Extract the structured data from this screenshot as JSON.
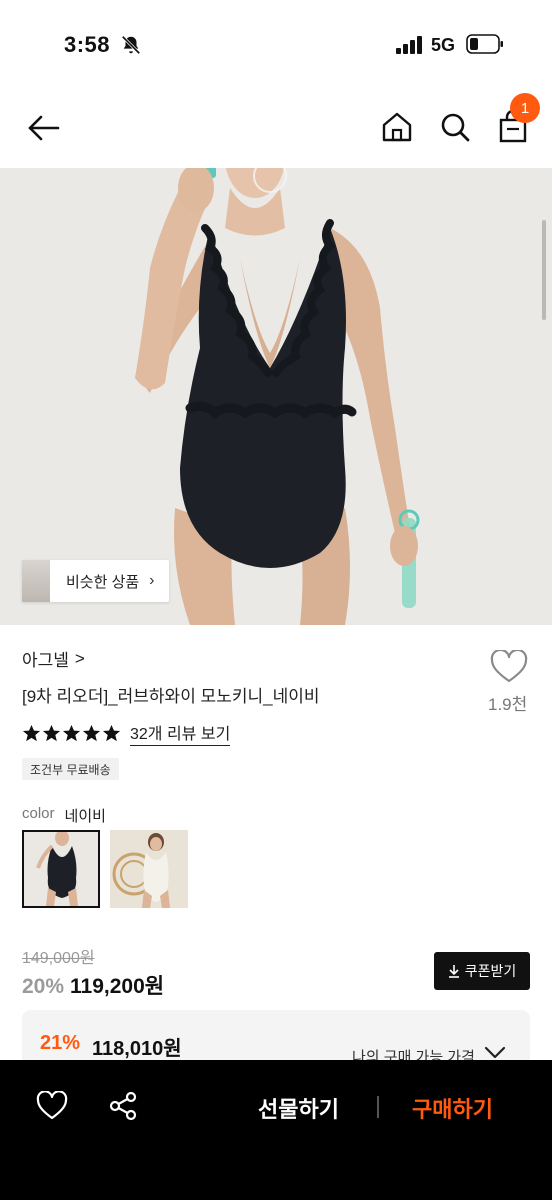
{
  "status": {
    "time": "3:58",
    "network": "5G"
  },
  "nav": {
    "cart_count": "1"
  },
  "hero": {
    "similar_label": "비슷한 상품",
    "chevron": "›"
  },
  "product": {
    "brand": "아그넬",
    "brand_chevron": ">",
    "name": "[9차 리오더]_러브하와이 모노키니_네이비",
    "like_count": "1.9천",
    "rating_stars": 5,
    "review_link": "32개 리뷰 보기",
    "shipping_badge": "조건부 무료배송",
    "color_label": "color",
    "color_value": "네이비"
  },
  "price": {
    "original": "149,000원",
    "discount": "20%",
    "sale": "119,200원",
    "coupon_label": "쿠폰받기",
    "best_discount": "21%",
    "best_price": "118,010원",
    "best_note": "나의 구매 가능 가격"
  },
  "bottom": {
    "gift_label": "선물하기",
    "buy_label": "구매하기"
  },
  "colors": {
    "accent": "#ff5a10",
    "black": "#000000"
  },
  "icons": [
    "bell-off-icon",
    "signal-icon",
    "battery-icon",
    "back-arrow-icon",
    "home-icon",
    "search-icon",
    "cart-icon",
    "heart-icon",
    "share-icon",
    "download-icon",
    "star-icon",
    "chevron-down-icon"
  ]
}
